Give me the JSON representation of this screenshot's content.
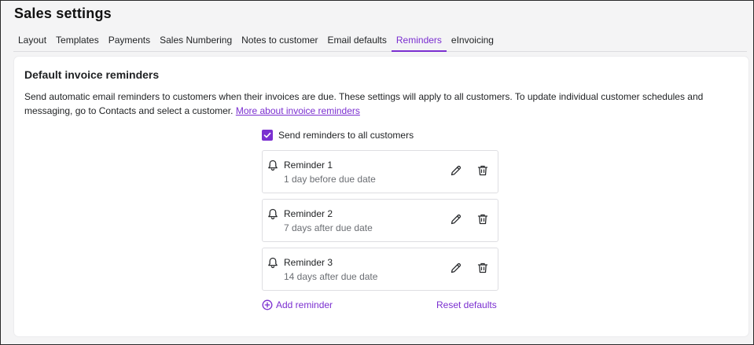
{
  "page": {
    "title": "Sales settings"
  },
  "tabs": [
    {
      "label": "Layout"
    },
    {
      "label": "Templates"
    },
    {
      "label": "Payments"
    },
    {
      "label": "Sales Numbering"
    },
    {
      "label": "Notes to customer"
    },
    {
      "label": "Email defaults"
    },
    {
      "label": "Reminders",
      "active": true
    },
    {
      "label": "eInvoicing"
    }
  ],
  "section": {
    "title": "Default invoice reminders",
    "description": "Send automatic email reminders to customers when their invoices are due. These settings will apply to all customers. To update individual customer schedules and messaging, go to Contacts and select a customer.",
    "link_label": "More about invoice reminders"
  },
  "send_all": {
    "label": "Send reminders to all customers",
    "checked": true
  },
  "reminders": [
    {
      "title": "Reminder 1",
      "schedule": "1 day before due date"
    },
    {
      "title": "Reminder 2",
      "schedule": "7 days after due date"
    },
    {
      "title": "Reminder 3",
      "schedule": "14 days after due date"
    }
  ],
  "actions": {
    "add_label": "Add reminder",
    "reset_label": "Reset defaults"
  },
  "colors": {
    "accent": "#7b2fd0",
    "text": "#1f2123",
    "muted": "#6b6e73"
  },
  "icons": {
    "reminder": "bell-icon",
    "edit": "pencil-icon",
    "delete": "trash-icon",
    "add": "plus-circle-icon",
    "check": "checkmark-icon"
  }
}
